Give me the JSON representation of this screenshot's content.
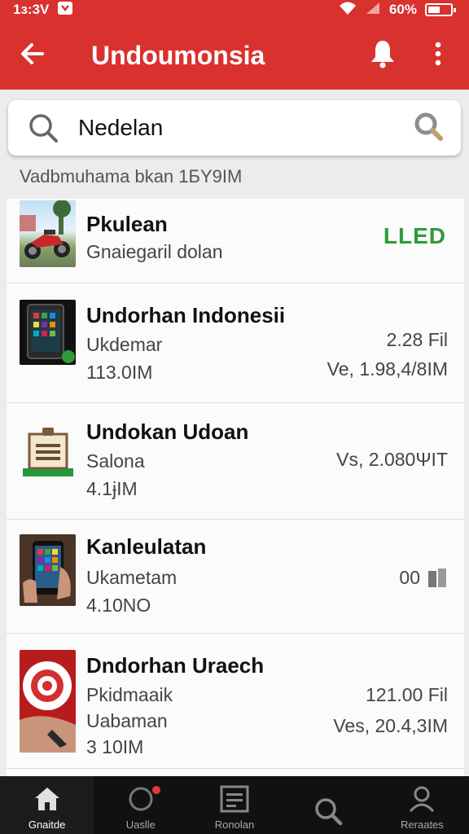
{
  "status": {
    "time": "1з:3V",
    "battery": "60%"
  },
  "appbar": {
    "title": "Undoumonsia"
  },
  "search": {
    "value": "Nedelan",
    "placeholder": ""
  },
  "subtitle": "Vadbmuhama bkan 1БY9IM",
  "items": [
    {
      "name": "Pkulean",
      "line1": "Gnaiegaril dolan",
      "line2": "",
      "right1": "",
      "right2": "",
      "badge": "LLED",
      "thumb": "motorbike-photo"
    },
    {
      "name": "Undorhan Indonesii",
      "line1": "Ukdemar",
      "line2": "113.0IM",
      "right1": "2.28 Fil",
      "right2": "Ve, 1.98,4/8IM",
      "badge": "",
      "thumb": "tablet-apps-photo"
    },
    {
      "name": "Undokan Udoan",
      "line1": "Salona",
      "line2": "4.1ɉIM",
      "right1": "Vs, 2.080ΨIT",
      "right2": "",
      "badge": "",
      "thumb": "document-box-icon"
    },
    {
      "name": "Kanleulatan",
      "line1": "Ukametam",
      "line2": "4.10NO",
      "right1": "00",
      "right2": "",
      "badge": "",
      "thumb": "phone-in-hand-photo"
    },
    {
      "name": "Dndorhan Uraech",
      "line1": "Pkidmaaik",
      "line2": "Uabaman",
      "line3": "3 10IM",
      "right1": "121.00 Fil",
      "right2": "Ves, 20.4,3IM",
      "badge": "",
      "thumb": "target-logo-photo"
    }
  ],
  "nav": [
    {
      "label": "Gnaitde",
      "icon": "home-icon"
    },
    {
      "label": "Uaslle",
      "icon": "notification-icon"
    },
    {
      "label": "Ronolan",
      "icon": "list-box-icon"
    },
    {
      "label": "",
      "icon": "search-icon"
    },
    {
      "label": "Reraates",
      "icon": "profile-icon"
    }
  ],
  "colors": {
    "accent": "#d9312e",
    "badge": "#2e9a3b",
    "nav_bg": "#111111"
  }
}
